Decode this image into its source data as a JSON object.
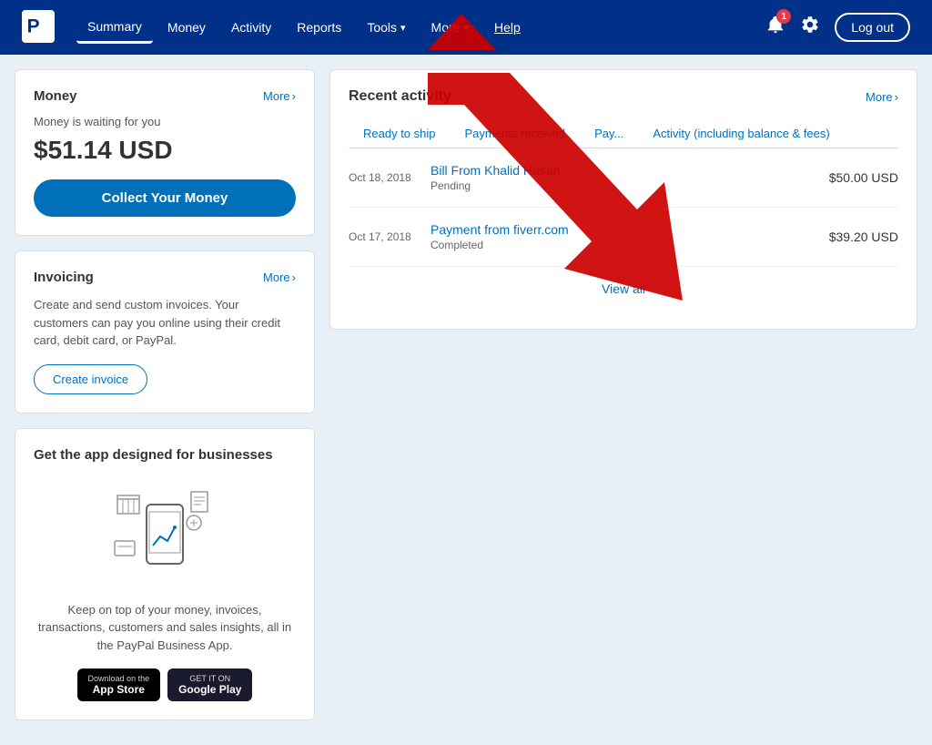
{
  "header": {
    "logo_alt": "PayPal",
    "nav": [
      {
        "label": "Summary",
        "id": "summary",
        "active": true
      },
      {
        "label": "Money",
        "id": "money",
        "active": false
      },
      {
        "label": "Activity",
        "id": "activity",
        "active": false
      },
      {
        "label": "Reports",
        "id": "reports",
        "active": false
      },
      {
        "label": "Tools",
        "id": "tools",
        "active": false,
        "dropdown": true
      },
      {
        "label": "More",
        "id": "more",
        "active": false,
        "dropdown": true
      },
      {
        "label": "Help",
        "id": "help",
        "active": false,
        "highlight": true
      }
    ],
    "notification_count": "1",
    "logout_label": "Log out"
  },
  "money_card": {
    "title": "Money",
    "more_label": "More",
    "subtitle": "Money is waiting for you",
    "amount": "$51.14 USD",
    "collect_btn": "Collect Your Money"
  },
  "invoicing_card": {
    "title": "Invoicing",
    "more_label": "More",
    "description": "Create and send custom invoices. Your customers can pay you online using their credit card, debit card, or PayPal.",
    "create_btn": "Create invoice"
  },
  "app_card": {
    "title": "Get the app designed for businesses",
    "description": "Keep on top of your money, invoices, transactions, customers and sales insights, all in the PayPal Business App.",
    "apple_store_top": "Download on the",
    "apple_store_main": "App Store",
    "google_store_top": "GET IT ON",
    "google_store_main": "Google Play"
  },
  "activity": {
    "title": "Recent activity",
    "more_label": "More",
    "tabs": [
      {
        "label": "Ready to ship",
        "id": "ready-to-ship"
      },
      {
        "label": "Payments received",
        "id": "payments-received"
      },
      {
        "label": "Pay...",
        "id": "pay"
      },
      {
        "label": "Activity (including balance & fees)",
        "id": "all-activity"
      }
    ],
    "rows": [
      {
        "date": "Oct 18, 2018",
        "name": "Bill From Khalid Hasan",
        "status": "Pending",
        "amount": "$50.00 USD"
      },
      {
        "date": "Oct 17, 2018",
        "name": "Payment from fiverr.com",
        "status": "Completed",
        "amount": "$39.20 USD"
      }
    ],
    "view_all": "View all"
  }
}
